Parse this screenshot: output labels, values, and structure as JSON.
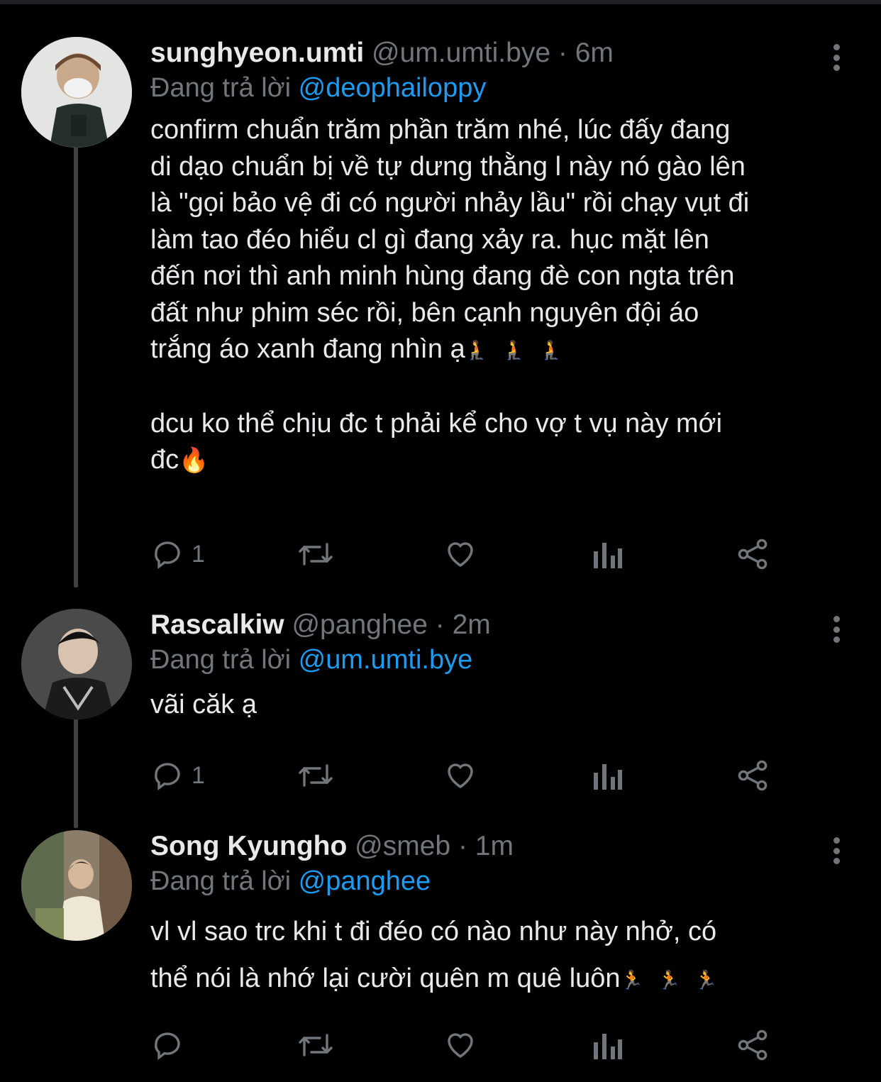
{
  "tweets": [
    {
      "name": "sunghyeon.umti",
      "handle": "@um.umti.bye",
      "separator": "·",
      "time": "6m",
      "reply_prefix": "Đang trả lời",
      "reply_to": "@deophailoppy",
      "paragraphs": [
        "confirm chuẩn trăm phần trăm nhé, lúc đấy đang\ndi dạo chuẩn bị về tự dưng thằng l này nó gào lên\nlà \"gọi bảo vệ đi có người nhảy lầu\" rồi chạy vụt đi\nlàm tao đéo hiểu cl gì đang xảy ra. hục mặt lên\nđến nơi thì anh minh hùng đang đè con ngta trên\nđất như phim séc rồi, bên cạnh nguyên đội áo\ntrắng áo xanh đang nhìn ạ",
        "dcu ko thể chịu đc t phải kể cho vợ t vụ này mới\nđc"
      ],
      "emoji_after_p1": "🧎🧎🧎",
      "emoji_after_p2": "🔥",
      "reply_count": "1",
      "avatar_color": "#d9d9d9"
    },
    {
      "name": "Rascalkiw",
      "handle": "@panghee",
      "separator": "·",
      "time": "2m",
      "reply_prefix": "Đang trả lời",
      "reply_to": "@um.umti.bye",
      "paragraphs": [
        "vãi căk ạ"
      ],
      "reply_count": "1",
      "avatar_color": "#3a3a3a"
    },
    {
      "name": "Song Kyungho",
      "handle": "@smeb",
      "separator": "·",
      "time": "1m",
      "reply_prefix": "Đang trả lời",
      "reply_to": "@panghee",
      "paragraphs": [
        "vl vl sao trc khi t đi đéo có nào như này nhở, có\nthể nói là nhớ lại cười quên m quê luôn"
      ],
      "emoji_after_p1": "🏃🏃🏃",
      "reply_count": "",
      "avatar_color": "#6b6152"
    }
  ],
  "icons": [
    "reply-icon",
    "retweet-icon",
    "like-icon",
    "views-icon",
    "share-icon",
    "more-icon"
  ],
  "colors": {
    "background": "#000000",
    "text": "#e7e9ea",
    "muted": "#71767b",
    "mention": "#1d9bf0",
    "thread": "#3e4144"
  }
}
